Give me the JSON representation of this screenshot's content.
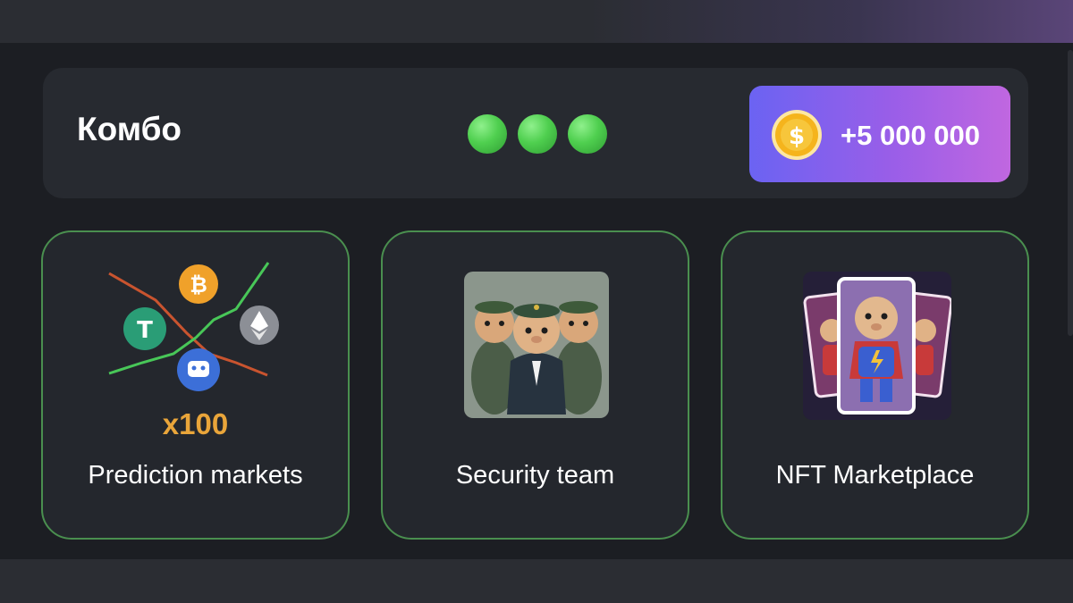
{
  "combo": {
    "title": "Комбо",
    "found_indicators": 3,
    "reward": "+5 000 000",
    "coin_symbol": "$",
    "colors": {
      "indicator": "#4fcf4f",
      "reward_gradient_start": "#6b63f2",
      "reward_gradient_end": "#c067e0",
      "coin": "#f5b41c"
    }
  },
  "cards": [
    {
      "label": "Prediction markets",
      "icon": "crypto-chart-illustration",
      "multiplier": "x100"
    },
    {
      "label": "Security team",
      "icon": "hamster-guards-illustration"
    },
    {
      "label": "NFT Marketplace",
      "icon": "nft-cards-illustration"
    }
  ]
}
